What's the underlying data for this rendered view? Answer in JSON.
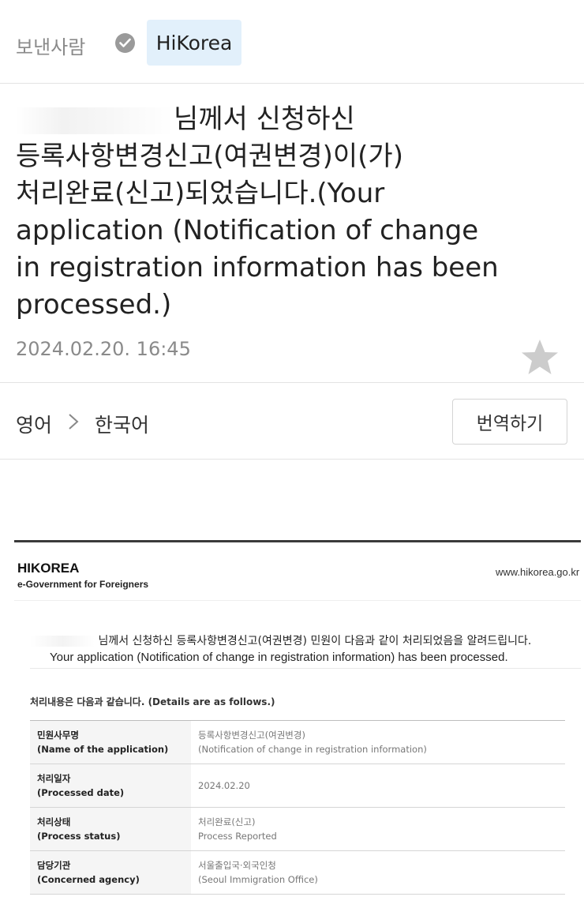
{
  "header": {
    "sender_label": "보낸사람",
    "sender_name": "HiKorea"
  },
  "message": {
    "subject_line1": "님께서 신청하신",
    "subject_line2": "등록사항변경신고(여권변경)이(가)",
    "subject_line3": "처리완료(신고)되었습니다.(Your",
    "subject_line4": "application (Notification of change",
    "subject_line5": "in registration information has been",
    "subject_line6": "processed.)",
    "date": "2024.02.20. 16:45"
  },
  "translate": {
    "from_lang": "영어",
    "to_lang": "한국어",
    "button_label": "번역하기"
  },
  "email": {
    "brand": "HIKOREA",
    "brand_sub": "e-Government for Foreigners",
    "url": "www.hikorea.go.kr",
    "notice_ko": "님께서 신청하신 등록사항변경신고(여권변경) 민원이 다음과 같이 처리되었음을 알려드립니다.",
    "notice_en": "Your application (Notification of change in registration information) has been processed.",
    "details_caption": "처리내용은 다음과 같습니다. (Details are as follows.)",
    "rows": [
      {
        "label_ko": "민원사무명",
        "label_en": "(Name of the application)",
        "value1": "등록사항변경신고(여권변경)",
        "value2": "(Notification of change in registration information)"
      },
      {
        "label_ko": "처리일자",
        "label_en": "(Processed date)",
        "value1": "2024.02.20",
        "value2": ""
      },
      {
        "label_ko": "처리상태",
        "label_en": "(Process status)",
        "value1": "처리완료(신고)",
        "value2": "Process Reported"
      },
      {
        "label_ko": "담당기관",
        "label_en": "(Concerned agency)",
        "value1": "서울출입국·외국인청",
        "value2": "(Seoul Immigration Office)"
      }
    ]
  },
  "colors": {
    "chip_bg": "#e2f0fb",
    "muted_text": "#8a8a8a",
    "star": "#cccccc",
    "rule_dark": "#3a3a3a"
  },
  "icons": [
    "check-circle-icon",
    "star-icon",
    "chevron-right-icon"
  ]
}
